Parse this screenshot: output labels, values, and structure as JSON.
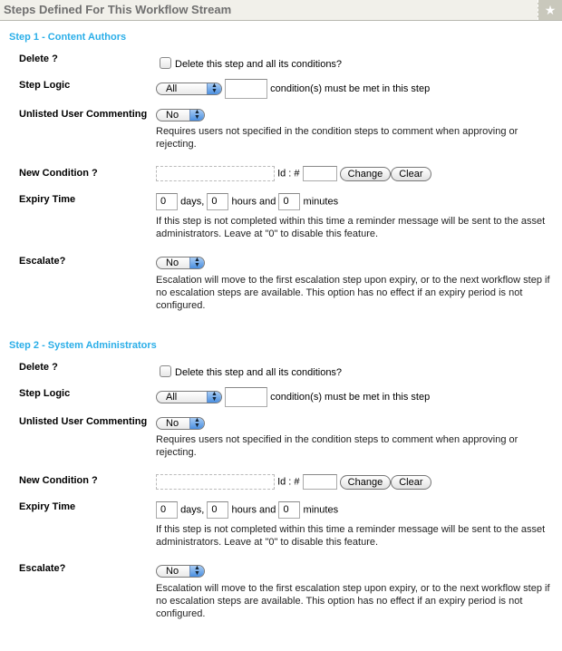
{
  "header": {
    "title": "Steps Defined For This Workflow Stream",
    "star_icon": "★"
  },
  "labels": {
    "delete": "Delete ?",
    "step_logic": "Step Logic",
    "unlisted": "Unlisted User Commenting",
    "new_condition": "New Condition ?",
    "expiry": "Expiry Time",
    "escalate": "Escalate?"
  },
  "text": {
    "delete_checkbox": "Delete this step and all its conditions?",
    "conditions_suffix": "condition(s) must be met in this step",
    "unlisted_note": "Requires users not specified in the condition steps to comment when approving or rejecting.",
    "id_label": "Id : #",
    "change_button": "Change",
    "clear_button": "Clear",
    "days": "days,",
    "hours": "hours and",
    "minutes": "minutes",
    "expiry_note": "If this step is not completed within this time a reminder message will be sent to the asset administrators. Leave at \"0\" to disable this feature.",
    "escalate_note": "Escalation will move to the first escalation step upon expiry, or to the next workflow step if no escalation steps are available. This option has no effect if an expiry period is not configured."
  },
  "steps": [
    {
      "title": "Step 1 - Content Authors",
      "delete_checked": false,
      "step_logic": "All",
      "condition_count": "",
      "unlisted": "No",
      "condition_id": "",
      "days": "0",
      "hours": "0",
      "minutes": "0",
      "escalate": "No"
    },
    {
      "title": "Step 2 - System Administrators",
      "delete_checked": false,
      "step_logic": "All",
      "condition_count": "",
      "unlisted": "No",
      "condition_id": "",
      "days": "0",
      "hours": "0",
      "minutes": "0",
      "escalate": "No"
    }
  ]
}
